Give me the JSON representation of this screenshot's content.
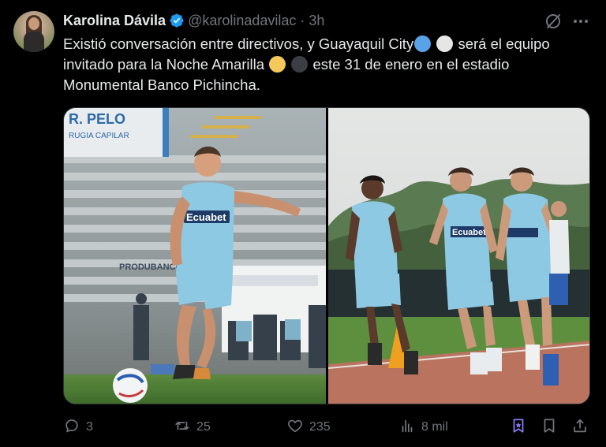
{
  "author": {
    "name": "Karolina Dávila",
    "handle": "@karolinadavilac",
    "separator": "·",
    "time": "3h",
    "verified": true
  },
  "tweet": {
    "line1_before": "Existió conversación entre directivos, y Guayaquil City",
    "line1_after": " será el equipo",
    "line2_before": "invitado para la Noche Amarilla ",
    "line2_after": " este 31 de enero en el estadio",
    "line3": "Monumental Banco Pichincha."
  },
  "emoji_colors": {
    "blue_circle": "#5aa2e8",
    "white_circle": "#e6e6e6",
    "yellow_circle": "#f5c85c",
    "black_circle": "#3b3e43"
  },
  "media": {
    "left_photo": {
      "jersey_text": "Ecuabet",
      "wall_text": "R. PELO",
      "wall_subtext": "RUGIA CAPILAR",
      "banner_text": "PRODUBANCO"
    },
    "right_photo": {
      "jersey_text": "Ecuabet"
    }
  },
  "actions": {
    "replies": "3",
    "reposts": "25",
    "likes": "235",
    "views": "8 mil"
  },
  "icons": [
    "verified-badge-icon",
    "grok-icon",
    "more-icon",
    "reply-icon",
    "repost-icon",
    "like-icon",
    "views-icon",
    "bookmark-icon",
    "save-icon",
    "share-icon"
  ],
  "colors": {
    "background": "#000000",
    "text": "#e7e9ea",
    "muted": "#71767b",
    "accent": "#1d9bf0",
    "highlight": "#8b7cf6"
  }
}
